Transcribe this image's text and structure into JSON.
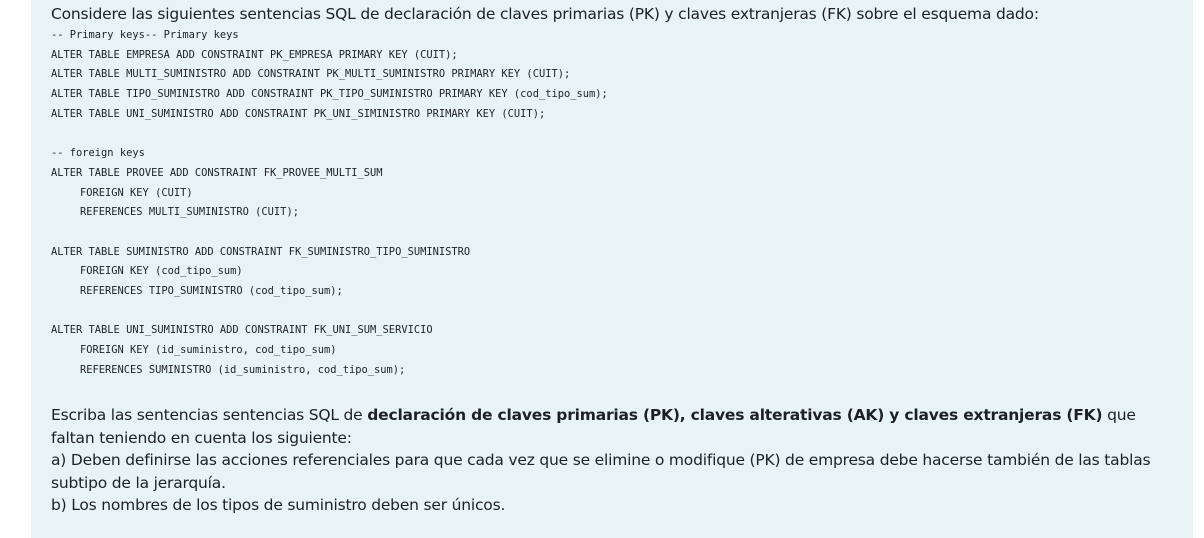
{
  "intro": "Considere las siguientes sentencias SQL de declaración de claves primarias (PK) y claves extranjeras (FK) sobre el esquema dado:",
  "code": {
    "line1": "-- Primary keys-- Primary keys",
    "line2": "ALTER TABLE EMPRESA ADD CONSTRAINT PK_EMPRESA PRIMARY KEY (CUIT);",
    "line3": "ALTER TABLE MULTI_SUMINISTRO ADD CONSTRAINT PK_MULTI_SUMINISTRO PRIMARY KEY (CUIT);",
    "line4": "ALTER TABLE TIPO_SUMINISTRO ADD CONSTRAINT PK_TIPO_SUMINISTRO PRIMARY KEY (cod_tipo_sum);",
    "line5": "ALTER TABLE UNI_SUMINISTRO ADD CONSTRAINT PK_UNI_SIMINISTRO PRIMARY KEY (CUIT);",
    "line6": "-- foreign keys",
    "line7": "ALTER TABLE PROVEE ADD CONSTRAINT FK_PROVEE_MULTI_SUM",
    "line8": "FOREIGN KEY (CUIT)",
    "line9": "REFERENCES MULTI_SUMINISTRO (CUIT);",
    "line10": "ALTER TABLE SUMINISTRO ADD CONSTRAINT FK_SUMINISTRO_TIPO_SUMINISTRO",
    "line11": "FOREIGN KEY (cod_tipo_sum)",
    "line12": "REFERENCES TIPO_SUMINISTRO (cod_tipo_sum);",
    "line13": "ALTER TABLE UNI_SUMINISTRO ADD CONSTRAINT FK_UNI_SUM_SERVICIO",
    "line14": "FOREIGN KEY (id_suministro, cod_tipo_sum)",
    "line15": "REFERENCES SUMINISTRO (id_suministro, cod_tipo_sum);"
  },
  "instructions": {
    "lead": "Escriba las sentencias sentencias SQL de ",
    "bold": "declaración de claves primarias (PK), claves alterativas (AK) y claves extranjeras (FK)",
    "tail": " que faltan teniendo en cuenta los siguiente:",
    "item_a": "a) Deben definirse las acciones referenciales para que cada vez que se elimine o modifique (PK) de empresa debe hacerse también de las tablas subtipo de la jerarquía.",
    "item_b": "b) Los nombres de los tipos de suministro deben ser únicos."
  }
}
